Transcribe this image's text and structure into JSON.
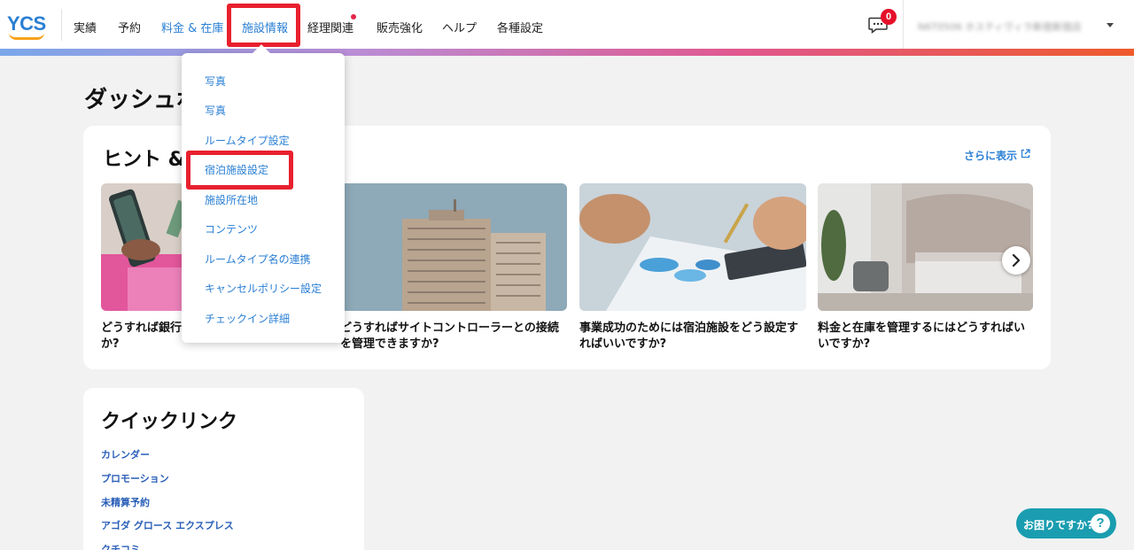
{
  "brand": {
    "logo_text": "YCS",
    "logo_color": "#2a7fd4",
    "smile_color": "#f7a21b"
  },
  "nav": {
    "items": [
      {
        "label": "実績"
      },
      {
        "label": "予約"
      },
      {
        "label": "料金 & 在庫"
      },
      {
        "label": "施設情報"
      },
      {
        "label": "経理関連"
      },
      {
        "label": "販売強化"
      },
      {
        "label": "ヘルプ"
      },
      {
        "label": "各種設定"
      }
    ],
    "notification_dot_on": "経理関連"
  },
  "chat": {
    "icon": "chat-bubble-icon",
    "badge_count": "0"
  },
  "account": {
    "label": "N6T0506 ホスティヴィラ新宿新宿店"
  },
  "page": {
    "title": "ダッシュボード"
  },
  "tips": {
    "title": "ヒント & お役立ち情報",
    "show_more": "さらに表示",
    "tiles": [
      {
        "title": "どうすれば銀行口座の情報を変更できますか?"
      },
      {
        "title": "どうすればサイトコントローラーとの接続を管理できますか?"
      },
      {
        "title": "事業成功のためには宿泊施設をどう設定すればいいですか?"
      },
      {
        "title": "料金と在庫を管理するにはどうすればいいですか?"
      }
    ]
  },
  "quick_links": {
    "title": "クイックリンク",
    "items": [
      "カレンダー",
      "プロモーション",
      "未精算予約",
      "アゴダ グロース エクスプレス",
      "クチコミ"
    ]
  },
  "dropdown": {
    "items": [
      "写真",
      "写真",
      "ルームタイプ設定",
      "宿泊施設設定",
      "施設所在地",
      "コンテンツ",
      "ルームタイプ名の連携",
      "キャンセルポリシー設定",
      "チェックイン詳細"
    ]
  },
  "help": {
    "label": "お困りですか?",
    "icon": "question-icon"
  },
  "colors": {
    "accent": "#2a7fd4",
    "highlight": "#e8202e",
    "badge": "#e5102a",
    "help": "#1a9db0"
  }
}
